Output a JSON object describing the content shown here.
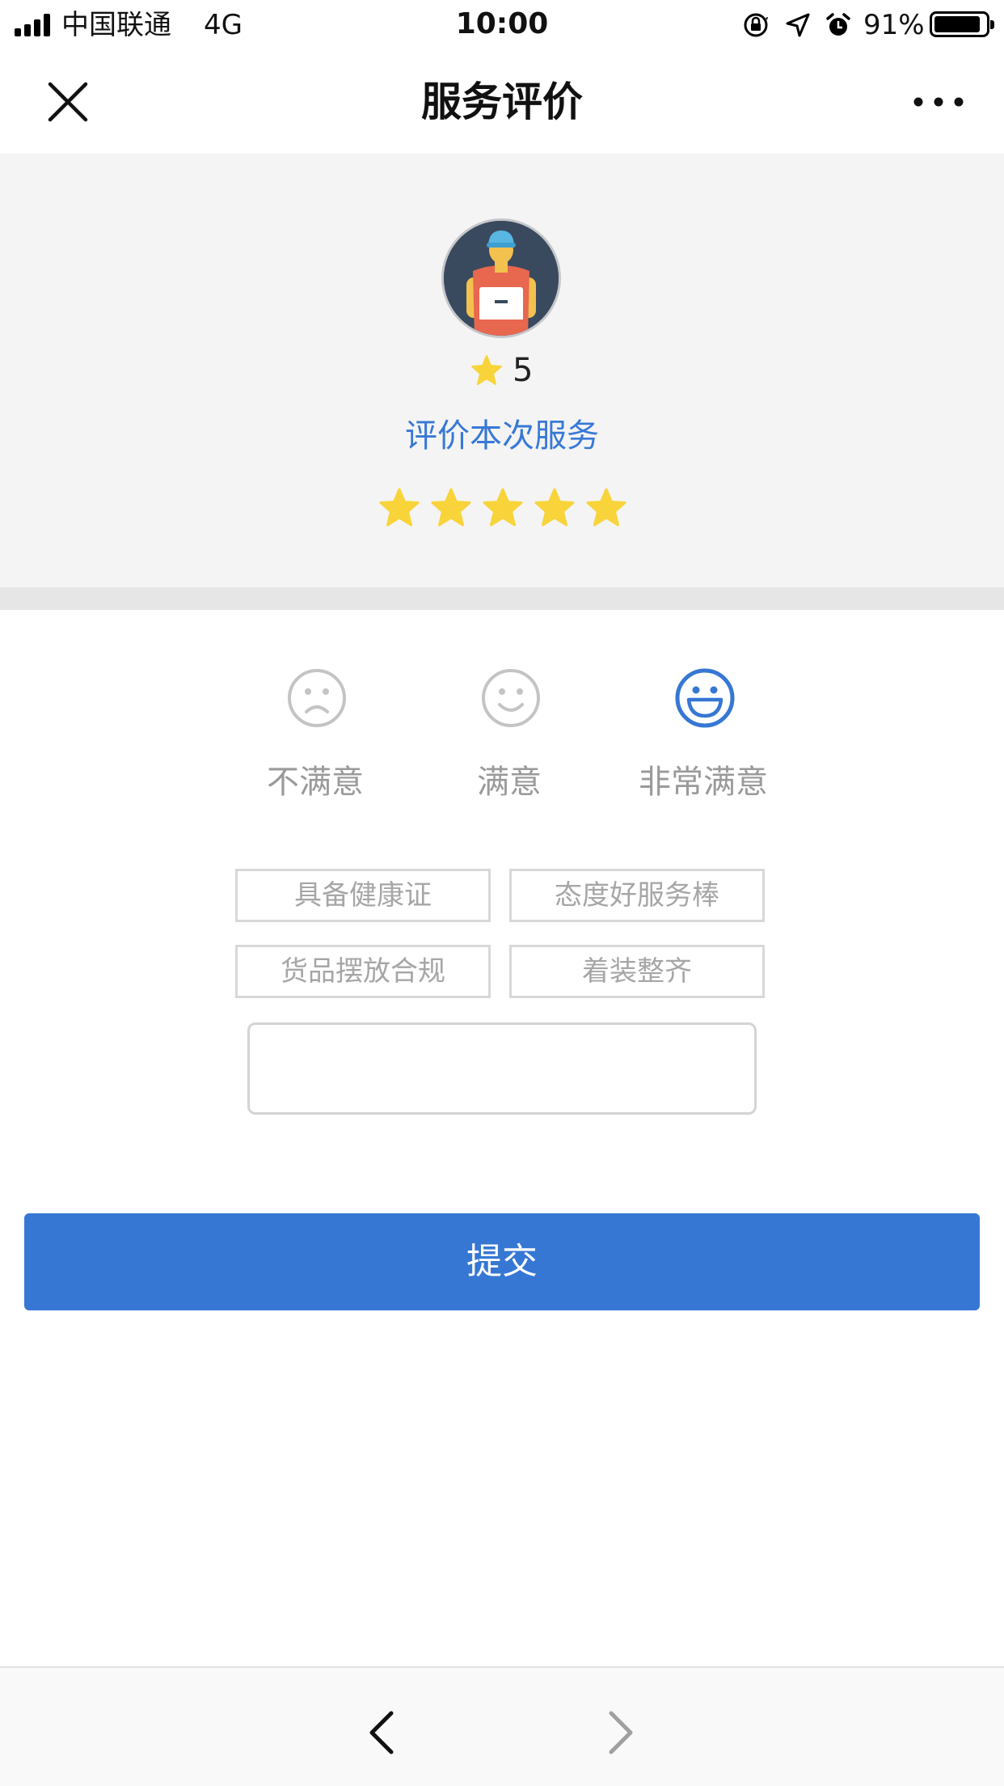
{
  "status_bar": {
    "carrier": "中国联通",
    "network": "4G",
    "time": "10:00",
    "battery_percent": "91%",
    "battery_level": 0.91,
    "icons": [
      "signal-icon",
      "orientation-lock-icon",
      "location-icon",
      "alarm-icon",
      "battery-icon"
    ]
  },
  "nav": {
    "title": "服务评价",
    "close_icon": "close-icon",
    "more_icon": "more-icon"
  },
  "courier": {
    "avatar": "courier-avatar",
    "score": "5",
    "score_icon": "star-icon"
  },
  "rating": {
    "title": "评价本次服务",
    "stars_filled": 5,
    "stars_total": 5,
    "star_color": "#f8d43a"
  },
  "moods": [
    {
      "label": "不满意",
      "icon": "sad-face-icon",
      "selected": false
    },
    {
      "label": "满意",
      "icon": "smile-face-icon",
      "selected": false
    },
    {
      "label": "非常满意",
      "icon": "grin-face-icon",
      "selected": true
    }
  ],
  "tags": [
    "具备健康证",
    "态度好服务棒",
    "货品摆放合规",
    "着装整齐"
  ],
  "comment": {
    "value": "",
    "placeholder": ""
  },
  "submit_label": "提交",
  "bottom_bar": {
    "back_icon": "back-arrow-icon",
    "forward_icon": "forward-arrow-icon"
  },
  "colors": {
    "accent": "#3677d3",
    "link": "#3879d6",
    "mood_selected": "#3677d3",
    "mood_unselected": "#c4c4c4",
    "header_bg": "#f4f4f4"
  }
}
